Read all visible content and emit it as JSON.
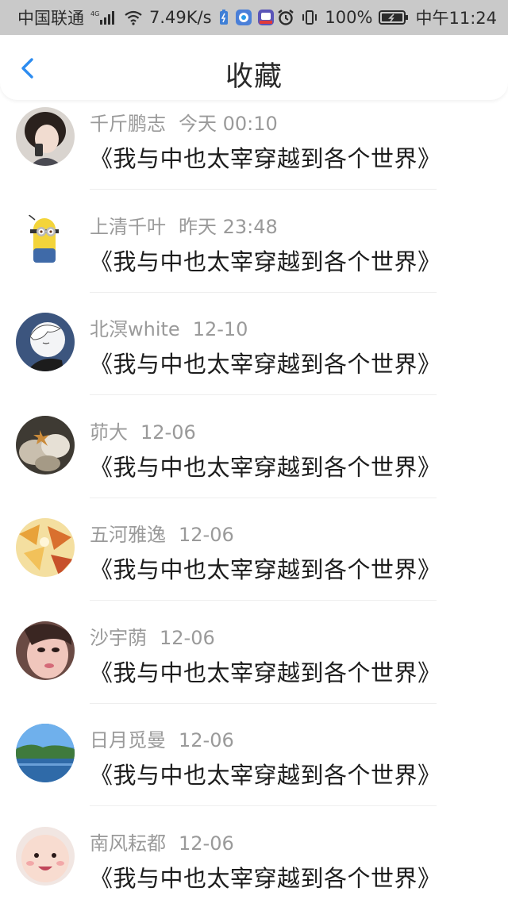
{
  "status_bar": {
    "carrier": "中国联通",
    "network": "4G",
    "speed": "7.49K/s",
    "battery": "100%",
    "time": "中午11:24"
  },
  "header": {
    "title": "收藏"
  },
  "colors": {
    "accent": "#2d8cf0",
    "status_bar_bg": "#c9c9c9",
    "meta_text": "#9a9a9a"
  },
  "favorites": [
    {
      "name": "千斤鹏志",
      "time": "今天 00:10",
      "book": "《我与中也太宰穿越到各个世界》",
      "avatar": "girl-photo"
    },
    {
      "name": "上清千叶",
      "time": "昨天 23:48",
      "book": "《我与中也太宰穿越到各个世界》",
      "avatar": "minion"
    },
    {
      "name": "北溟white",
      "time": "12-10",
      "book": "《我与中也太宰穿越到各个世界》",
      "avatar": "anime-sketch"
    },
    {
      "name": "茆大",
      "time": "12-06",
      "book": "《我与中也太宰穿越到各个世界》",
      "avatar": "stones"
    },
    {
      "name": "五河雅逸",
      "time": "12-06",
      "book": "《我与中也太宰穿越到各个世界》",
      "avatar": "autumn-leaves"
    },
    {
      "name": "沙宇荫",
      "time": "12-06",
      "book": "《我与中也太宰穿越到各个世界》",
      "avatar": "girl-selfie"
    },
    {
      "name": "日月觅曼",
      "time": "12-06",
      "book": "《我与中也太宰穿越到各个世界》",
      "avatar": "lake-landscape"
    },
    {
      "name": "南风耘都",
      "time": "12-06",
      "book": "《我与中也太宰穿越到各个世界》",
      "avatar": "baby-face"
    }
  ]
}
